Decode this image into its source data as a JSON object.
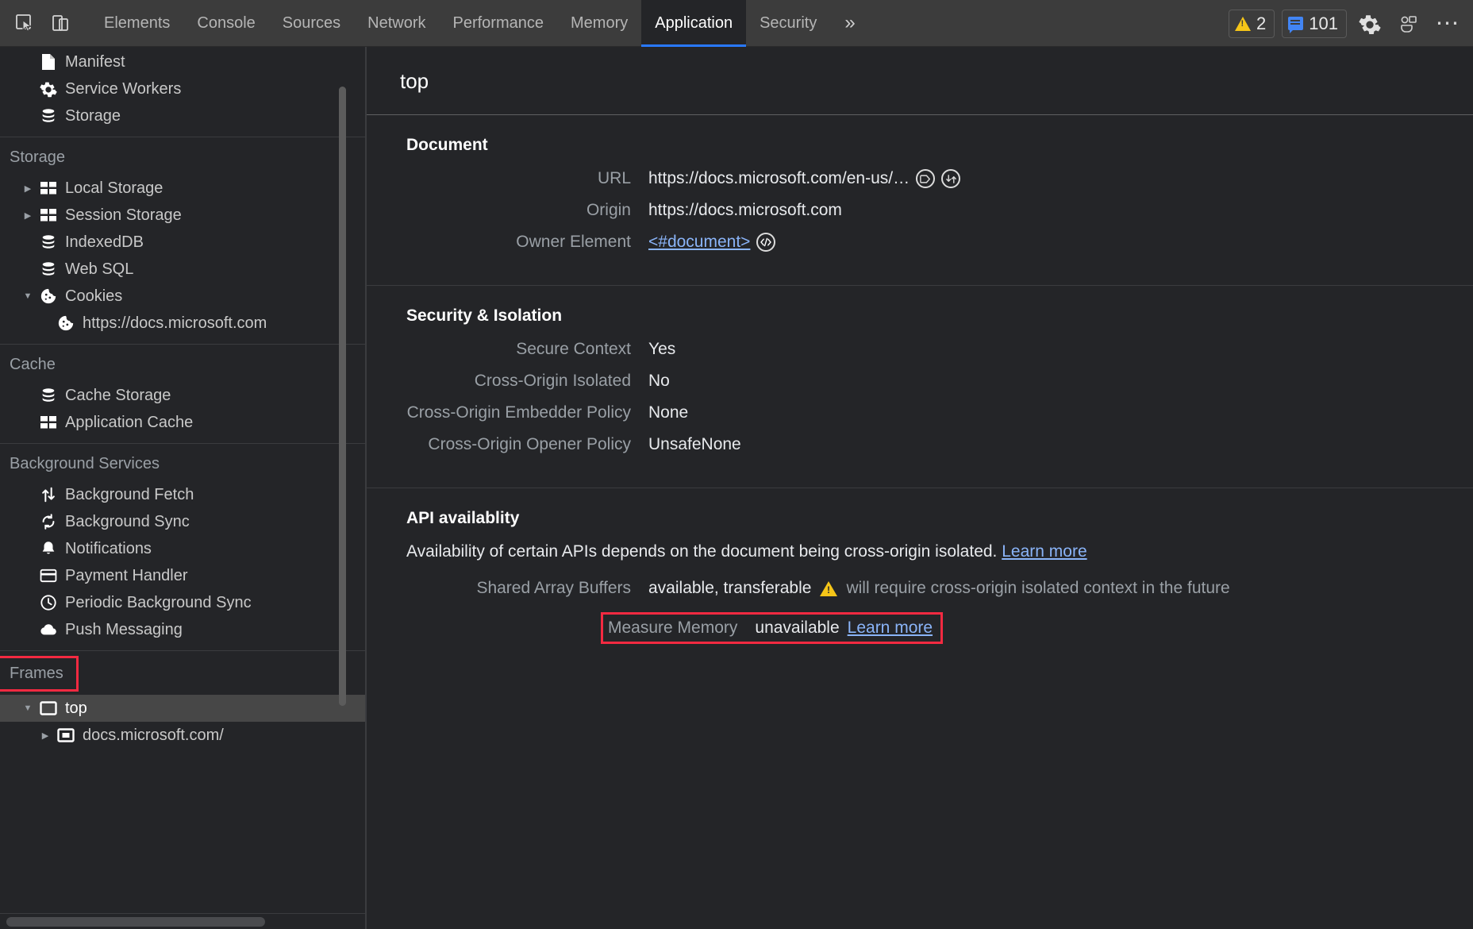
{
  "toolbar": {
    "inspect_icon": "inspect-element-icon",
    "device_icon": "device-toolbar-icon",
    "tabs": [
      {
        "label": "Elements",
        "active": false
      },
      {
        "label": "Console",
        "active": false
      },
      {
        "label": "Sources",
        "active": false
      },
      {
        "label": "Network",
        "active": false
      },
      {
        "label": "Performance",
        "active": false
      },
      {
        "label": "Memory",
        "active": false
      },
      {
        "label": "Application",
        "active": true
      },
      {
        "label": "Security",
        "active": false
      }
    ],
    "more_tabs_glyph": "»",
    "warning_count": "2",
    "message_count": "101",
    "settings_icon": "gear-icon",
    "devices_icon": "devices-icon",
    "more_options_glyph": "⋯"
  },
  "sidebar": {
    "application_items": [
      {
        "label": "Manifest",
        "icon": "manifest-document-icon",
        "indent": 1,
        "twisty": ""
      },
      {
        "label": "Service Workers",
        "icon": "gear-icon",
        "indent": 1,
        "twisty": ""
      },
      {
        "label": "Storage",
        "icon": "database-icon",
        "indent": 1,
        "twisty": ""
      }
    ],
    "storage_header": "Storage",
    "storage_items": [
      {
        "label": "Local Storage",
        "icon": "table-icon",
        "indent": 1,
        "twisty": "▶"
      },
      {
        "label": "Session Storage",
        "icon": "table-icon",
        "indent": 1,
        "twisty": "▶"
      },
      {
        "label": "IndexedDB",
        "icon": "database-icon",
        "indent": 1,
        "twisty": ""
      },
      {
        "label": "Web SQL",
        "icon": "database-icon",
        "indent": 1,
        "twisty": ""
      },
      {
        "label": "Cookies",
        "icon": "cookie-icon",
        "indent": 1,
        "twisty": "▼"
      },
      {
        "label": "https://docs.microsoft.com",
        "icon": "cookie-icon",
        "indent": 2,
        "twisty": ""
      }
    ],
    "cache_header": "Cache",
    "cache_items": [
      {
        "label": "Cache Storage",
        "icon": "database-icon",
        "indent": 1,
        "twisty": ""
      },
      {
        "label": "Application Cache",
        "icon": "table-icon",
        "indent": 1,
        "twisty": ""
      }
    ],
    "background_header": "Background Services",
    "background_items": [
      {
        "label": "Background Fetch",
        "icon": "arrows-up-down-icon",
        "indent": 1,
        "twisty": ""
      },
      {
        "label": "Background Sync",
        "icon": "sync-refresh-icon",
        "indent": 1,
        "twisty": ""
      },
      {
        "label": "Notifications",
        "icon": "bell-icon",
        "indent": 1,
        "twisty": ""
      },
      {
        "label": "Payment Handler",
        "icon": "credit-card-icon",
        "indent": 1,
        "twisty": ""
      },
      {
        "label": "Periodic Background Sync",
        "icon": "clock-icon",
        "indent": 1,
        "twisty": ""
      },
      {
        "label": "Push Messaging",
        "icon": "cloud-icon",
        "indent": 1,
        "twisty": ""
      }
    ],
    "frames_header": "Frames",
    "frames_items": [
      {
        "label": "top",
        "icon": "frame-icon",
        "indent": 1,
        "twisty": "▼",
        "selected": true
      },
      {
        "label": "docs.microsoft.com/",
        "icon": "nested-frame-icon",
        "indent": 2,
        "twisty": "▶",
        "selected": false
      }
    ]
  },
  "main": {
    "frame_title": "top",
    "document_section": {
      "title": "Document",
      "rows": [
        {
          "key": "URL",
          "value": "https://docs.microsoft.com/en-us/…"
        },
        {
          "key": "Origin",
          "value": "https://docs.microsoft.com"
        },
        {
          "key": "Owner Element",
          "value": "<#document>"
        }
      ],
      "url_tag_icon": "tag-circle-icon",
      "url_scroll_icon": "scroll-into-view-circle-icon",
      "owner_code_icon": "code-brackets-circle-icon"
    },
    "security_section": {
      "title": "Security & Isolation",
      "rows": [
        {
          "key": "Secure Context",
          "value": "Yes"
        },
        {
          "key": "Cross-Origin Isolated",
          "value": "No"
        },
        {
          "key": "Cross-Origin Embedder Policy",
          "value": "None"
        },
        {
          "key": "Cross-Origin Opener Policy",
          "value": "UnsafeNone"
        }
      ]
    },
    "api_section": {
      "title": "API availablity",
      "description": "Availability of certain APIs depends on the document being cross-origin isolated.",
      "description_link": "Learn more",
      "shared_array_buffers": {
        "key": "Shared Array Buffers",
        "value": "available, transferable",
        "warning": "will require cross-origin isolated context in the future"
      },
      "measure_memory": {
        "key": "Measure Memory",
        "value": "unavailable",
        "link": "Learn more"
      }
    }
  },
  "colors": {
    "accent_blue": "#2979ff",
    "link_blue": "#8ab4f8",
    "highlight_red": "#f42a41",
    "warning_yellow": "#f5c518",
    "panel_bg": "#242528",
    "toolbar_bg": "#3c3c3c"
  }
}
